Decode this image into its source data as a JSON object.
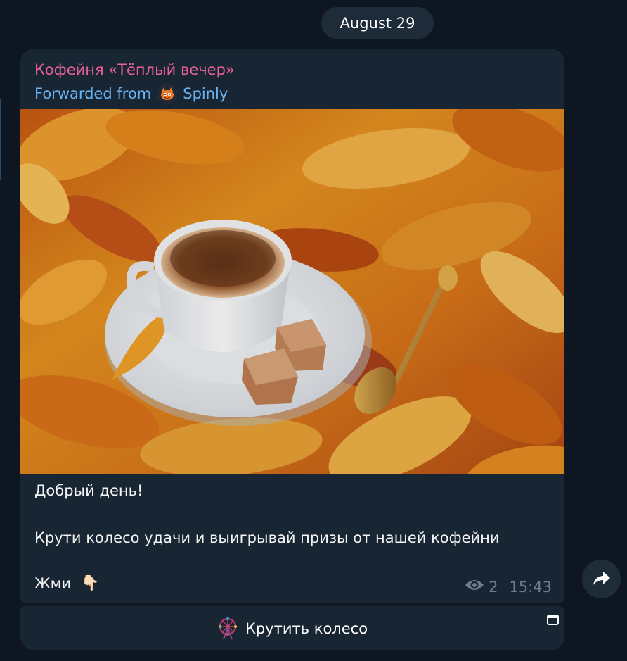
{
  "date_pill": "August 29",
  "message": {
    "sender": "Кофейня «Тёплый вечер»",
    "forwarded_prefix": "Forwarded from",
    "forwarded_name": "Spinly",
    "line1": "Добрый день!",
    "line2": "Крути колесо удачи и выигрывай призы от нашей кофейни",
    "line3": "Жми",
    "line3_emoji": "👇🏻",
    "views": "2",
    "time": "15:43"
  },
  "inline_button": {
    "label": "Крутить колесо"
  },
  "icons": {
    "views": "eye-icon",
    "share": "share-arrow-icon",
    "webapp": "webapp-window-icon",
    "button": "ferris-wheel-icon",
    "avatar": "spinly-avatar-icon"
  },
  "colors": {
    "background": "#0e1621",
    "bubble": "#182533",
    "sender": "#e9609c",
    "forwarded": "#6ab3f3",
    "meta": "#6d7f8f"
  }
}
